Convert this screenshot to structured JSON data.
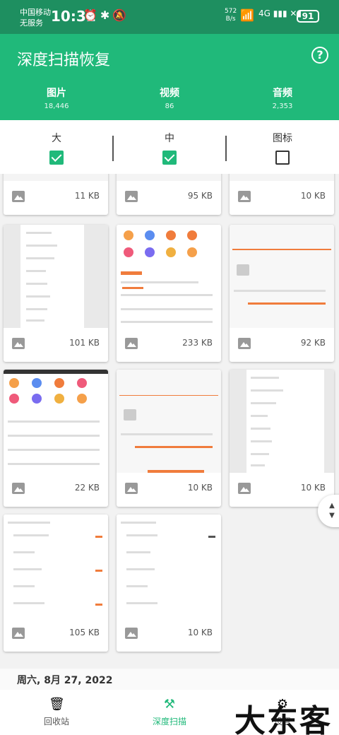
{
  "status_bar": {
    "carrier_1": "中国移动",
    "carrier_2": "无服务",
    "time": "10:31",
    "net_speed_value": "572",
    "net_speed_unit": "B/s",
    "network": "4G",
    "battery": "91"
  },
  "header": {
    "title": "深度扫描恢复",
    "help_icon": "question-circle-icon"
  },
  "tabs": [
    {
      "label": "图片",
      "count": "18,446",
      "active": true
    },
    {
      "label": "视频",
      "count": "86",
      "active": false
    },
    {
      "label": "音频",
      "count": "2,353",
      "active": false
    }
  ],
  "size_filter": [
    {
      "label": "大",
      "checked": true
    },
    {
      "label": "中",
      "checked": true
    },
    {
      "label": "图标",
      "checked": false
    }
  ],
  "grid": {
    "items": [
      {
        "size": "11 KB"
      },
      {
        "size": "95 KB"
      },
      {
        "size": "10 KB"
      },
      {
        "size": "101 KB"
      },
      {
        "size": "233 KB"
      },
      {
        "size": "92 KB"
      },
      {
        "size": "22 KB"
      },
      {
        "size": "10 KB"
      },
      {
        "size": "10 KB"
      },
      {
        "size": "105 KB"
      },
      {
        "size": "10 KB"
      }
    ]
  },
  "date_header": "周六, 8月 27, 2022",
  "bottom_nav": [
    {
      "label": "回收站",
      "icon": "trash-icon",
      "active": false
    },
    {
      "label": "深度扫描",
      "icon": "deep-scan-icon",
      "active": true
    },
    {
      "label": "设置",
      "icon": "gear-icon",
      "active": false
    }
  ],
  "watermark": "大东客",
  "colors": {
    "accent": "#20b97a",
    "status_bar": "#1e8f60",
    "thumb_orange": "#f07c3c"
  }
}
